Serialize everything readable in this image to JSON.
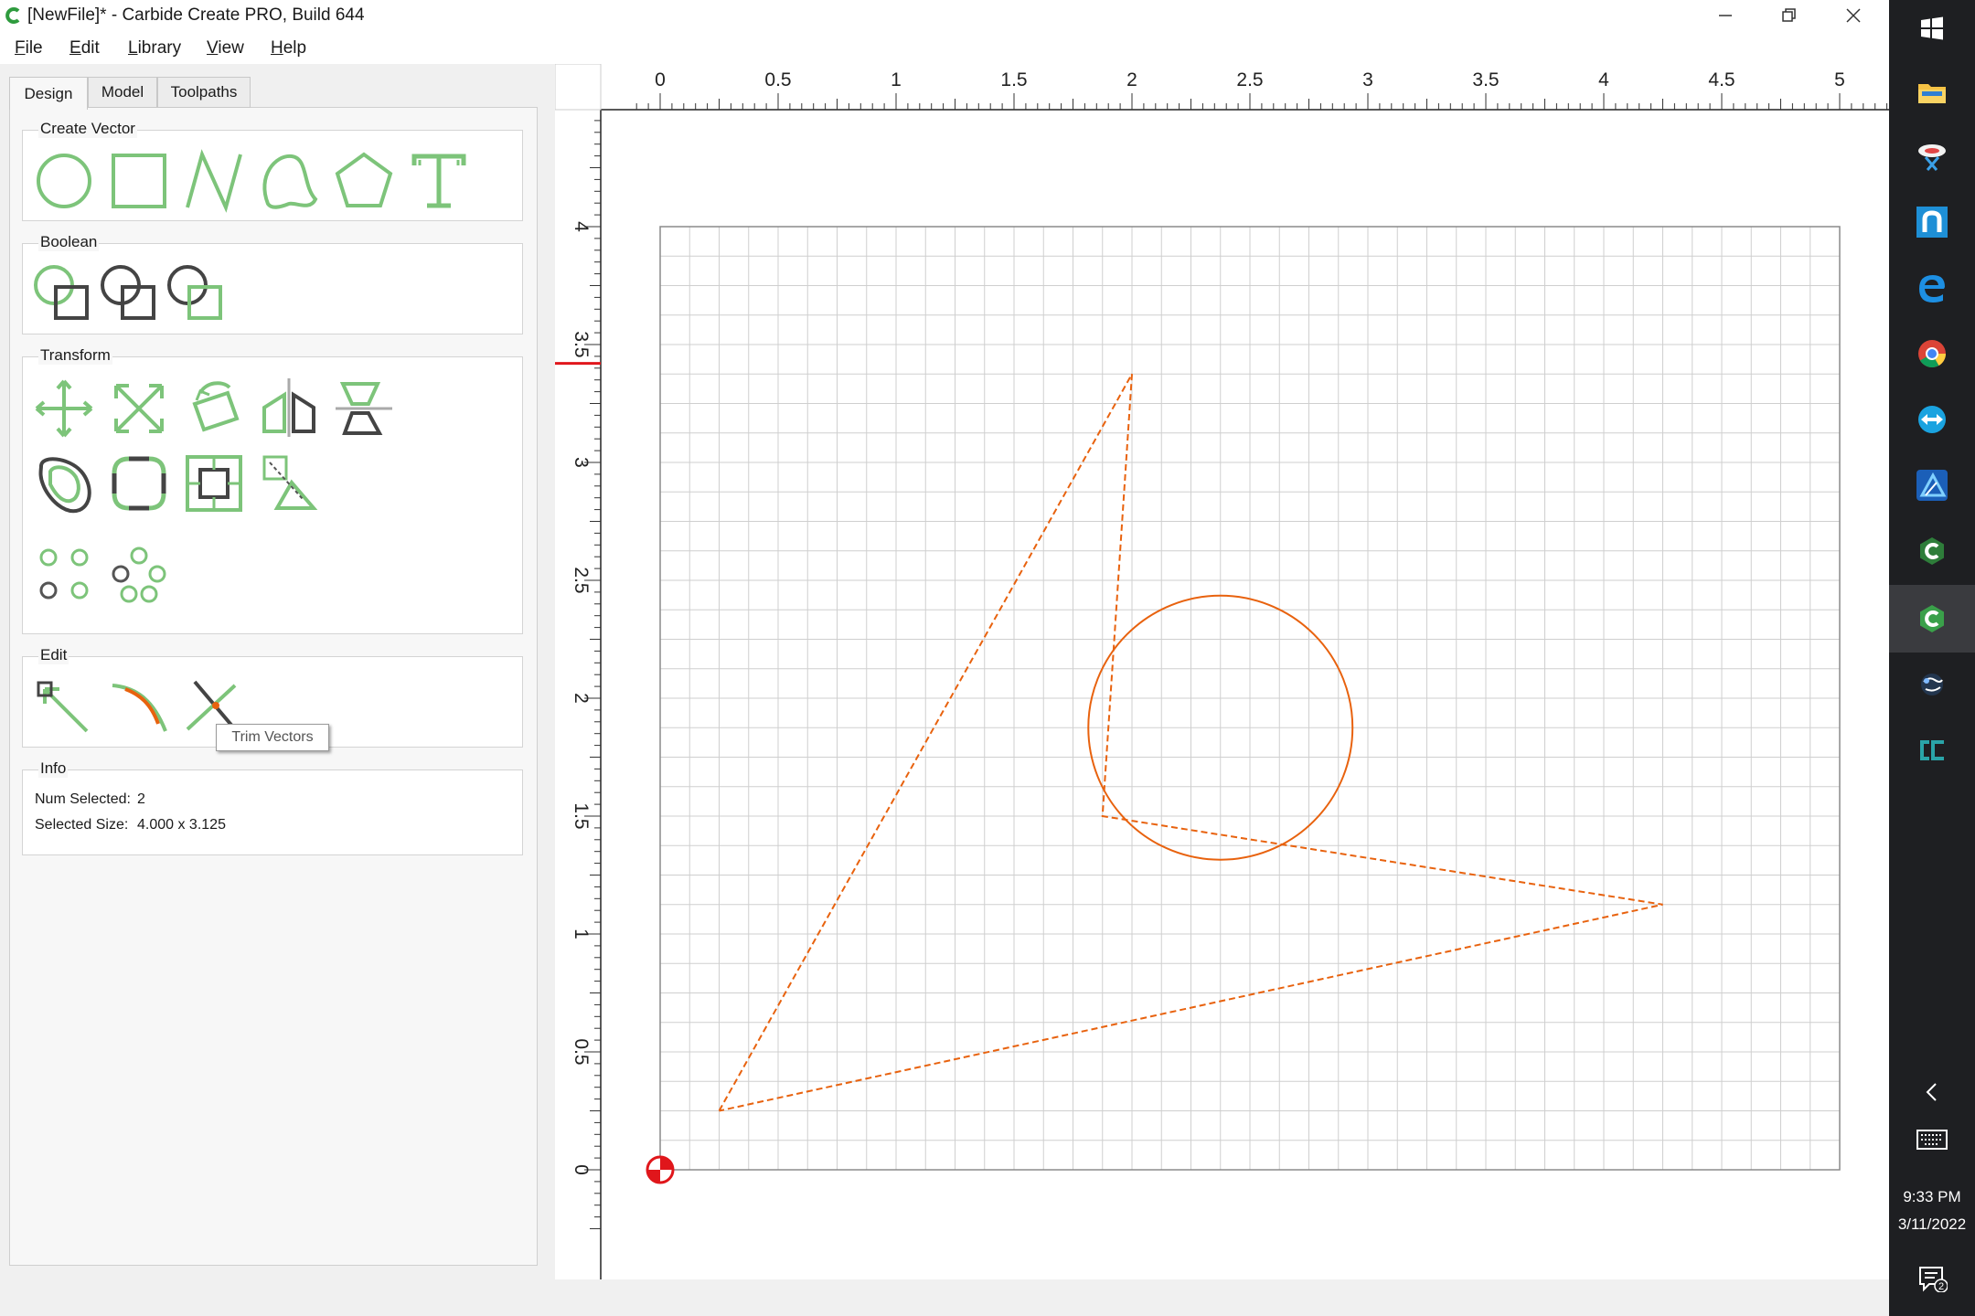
{
  "window": {
    "title": "[NewFile]* - Carbide Create PRO, Build 644"
  },
  "menu": [
    "File",
    "Edit",
    "Library",
    "View",
    "Help"
  ],
  "tabs": [
    "Design",
    "Model",
    "Toolpaths"
  ],
  "active_tab": "Design",
  "groups": {
    "create_vector": "Create Vector",
    "boolean": "Boolean",
    "transform": "Transform",
    "edit": "Edit",
    "info": "Info"
  },
  "info": {
    "num_selected_label": "Num Selected:",
    "num_selected_value": "2",
    "selected_size_label": "Selected Size:",
    "selected_size_value": "4.000 x 3.125"
  },
  "tooltip": "Trim Vectors",
  "ruler": {
    "x_labels": [
      "0",
      "0.5",
      "1",
      "1.5",
      "2",
      "2.5",
      "3",
      "3.5",
      "4",
      "4.5",
      "5"
    ],
    "y_labels": [
      "0",
      "0.5",
      "1",
      "1.5",
      "2",
      "2.5",
      "3",
      "3.5",
      "4"
    ]
  },
  "drawing": {
    "stock_width_in": 5.0,
    "stock_height_in": 4.0,
    "grid_spacing_in": 0.125,
    "polyline_in": [
      [
        0.25,
        0.25
      ],
      [
        2.0,
        3.375
      ],
      [
        1.875,
        1.5
      ],
      [
        4.25,
        1.125
      ],
      [
        0.25,
        0.25
      ]
    ],
    "circle": {
      "cx_in": 2.375,
      "cy_in": 1.875,
      "r_in": 0.56
    },
    "vector_color": "#e8620e",
    "origin_marker_color": "#e0161b"
  },
  "taskbar": {
    "time": "9:33 PM",
    "date": "3/11/2022",
    "notification_count": "2"
  }
}
